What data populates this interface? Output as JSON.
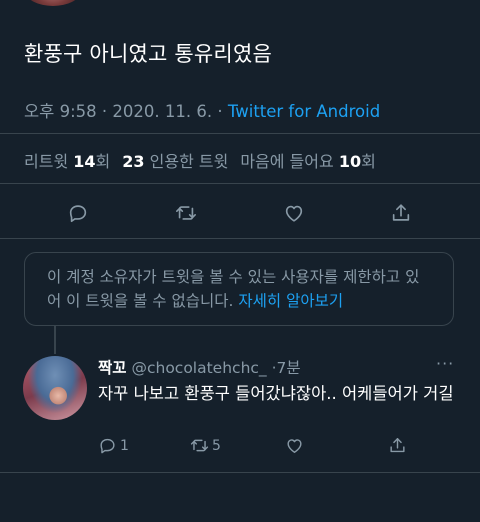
{
  "tweet": {
    "text": "환풍구 아니였고 통유리였음",
    "time": "오후 9:58",
    "date": "2020. 11. 6.",
    "source": "Twitter for Android"
  },
  "stats": {
    "retweets_label": "리트윗",
    "retweets_count": "14",
    "retweets_unit": "회",
    "quotes_count": "23",
    "quotes_label": "인용한 트윗",
    "likes_label": "마음에 들어요",
    "likes_count": "10",
    "likes_unit": "회"
  },
  "actions": [
    "reply-icon",
    "retweet-icon",
    "like-icon",
    "share-icon"
  ],
  "notice": {
    "text": "이 계정 소유자가 트윗을 볼 수 있는 사용자를 제한하고 있어 이 트윗을 볼 수 없습니다.",
    "link": "자세히 알아보기"
  },
  "reply": {
    "name": "짝꼬",
    "handle": "@chocolatehchc_",
    "separator": "·",
    "time": "7분",
    "more": "···",
    "text": "자꾸 나보고 환풍구 들어갔냐잖아.. 어케들어가 거길",
    "reply_count": "1",
    "retweet_count": "5",
    "like_count": ""
  },
  "colors": {
    "background": "#15202b",
    "secondary_text": "#8899a6",
    "accent": "#1da1f2",
    "border": "#38444d"
  }
}
